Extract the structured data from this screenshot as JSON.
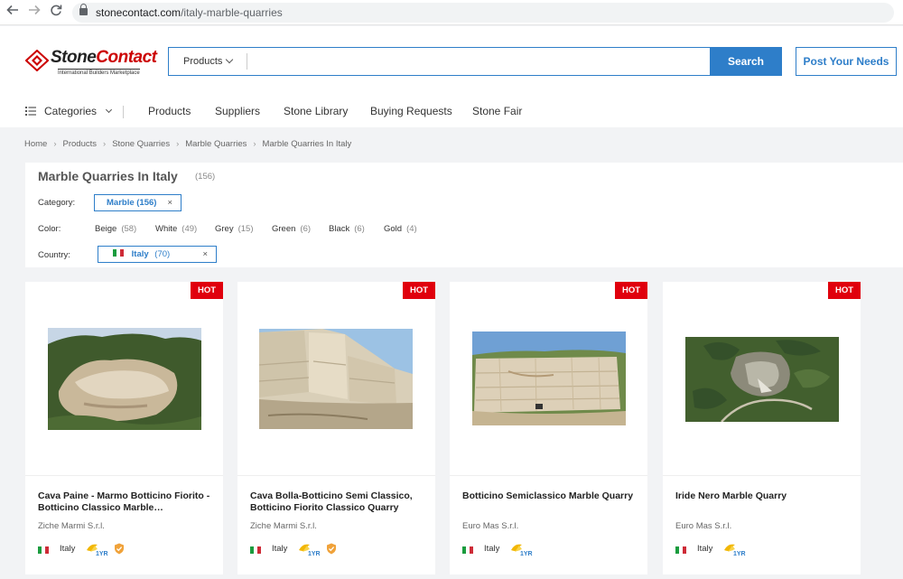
{
  "browser": {
    "url_domain": "stonecontact.com",
    "url_path": "/italy-marble-quarries"
  },
  "header": {
    "logo_stone": "Stone",
    "logo_contact": "Contact",
    "logo_tagline": "International Builders Marketplace",
    "search_category": "Products",
    "search_placeholder": "",
    "search_button": "Search",
    "post_button": "Post Your Needs"
  },
  "nav": {
    "categories_label": "Categories",
    "links": [
      "Products",
      "Suppliers",
      "Stone Library",
      "Buying Requests",
      "Stone Fair"
    ]
  },
  "breadcrumb": [
    "Home",
    "Products",
    "Stone Quarries",
    "Marble Quarries",
    "Marble Quarries In Italy"
  ],
  "filters": {
    "title": "Marble Quarries In Italy",
    "count": "(156)",
    "category_label": "Category:",
    "category_chip": "Marble (156)",
    "color_label": "Color:",
    "colors": [
      {
        "name": "Beige",
        "count": "(58)"
      },
      {
        "name": "White",
        "count": "(49)"
      },
      {
        "name": "Grey",
        "count": "(15)"
      },
      {
        "name": "Green",
        "count": "(6)"
      },
      {
        "name": "Black",
        "count": "(6)"
      },
      {
        "name": "Gold",
        "count": "(4)"
      }
    ],
    "country_label": "Country:",
    "country_chip_name": "Italy",
    "country_chip_count": "(70)",
    "remove_symbol": "×"
  },
  "products": [
    {
      "badge": "HOT",
      "name": "Cava Paine - Marmo Botticino Fiorito - Botticino Classico Marble…",
      "supplier": "Ziche Marmi S.r.l.",
      "country": "Italy",
      "years_badge": "1YR",
      "verified": true
    },
    {
      "badge": "HOT",
      "name": "Cava Bolla-Botticino Semi Classico, Botticino Fiorito Classico Quarry",
      "supplier": "Ziche Marmi S.r.l.",
      "country": "Italy",
      "years_badge": "1YR",
      "verified": true
    },
    {
      "badge": "HOT",
      "name": "Botticino Semiclassico Marble Quarry",
      "supplier": "Euro Mas S.r.l.",
      "country": "Italy",
      "years_badge": "1YR",
      "verified": false
    },
    {
      "badge": "HOT",
      "name": "Iride Nero Marble Quarry",
      "supplier": "Euro Mas S.r.l.",
      "country": "Italy",
      "years_badge": "1YR",
      "verified": false
    }
  ],
  "colors": {
    "accent": "#2e7ec9",
    "hot": "#e0000d",
    "logo_red": "#cc0000"
  }
}
